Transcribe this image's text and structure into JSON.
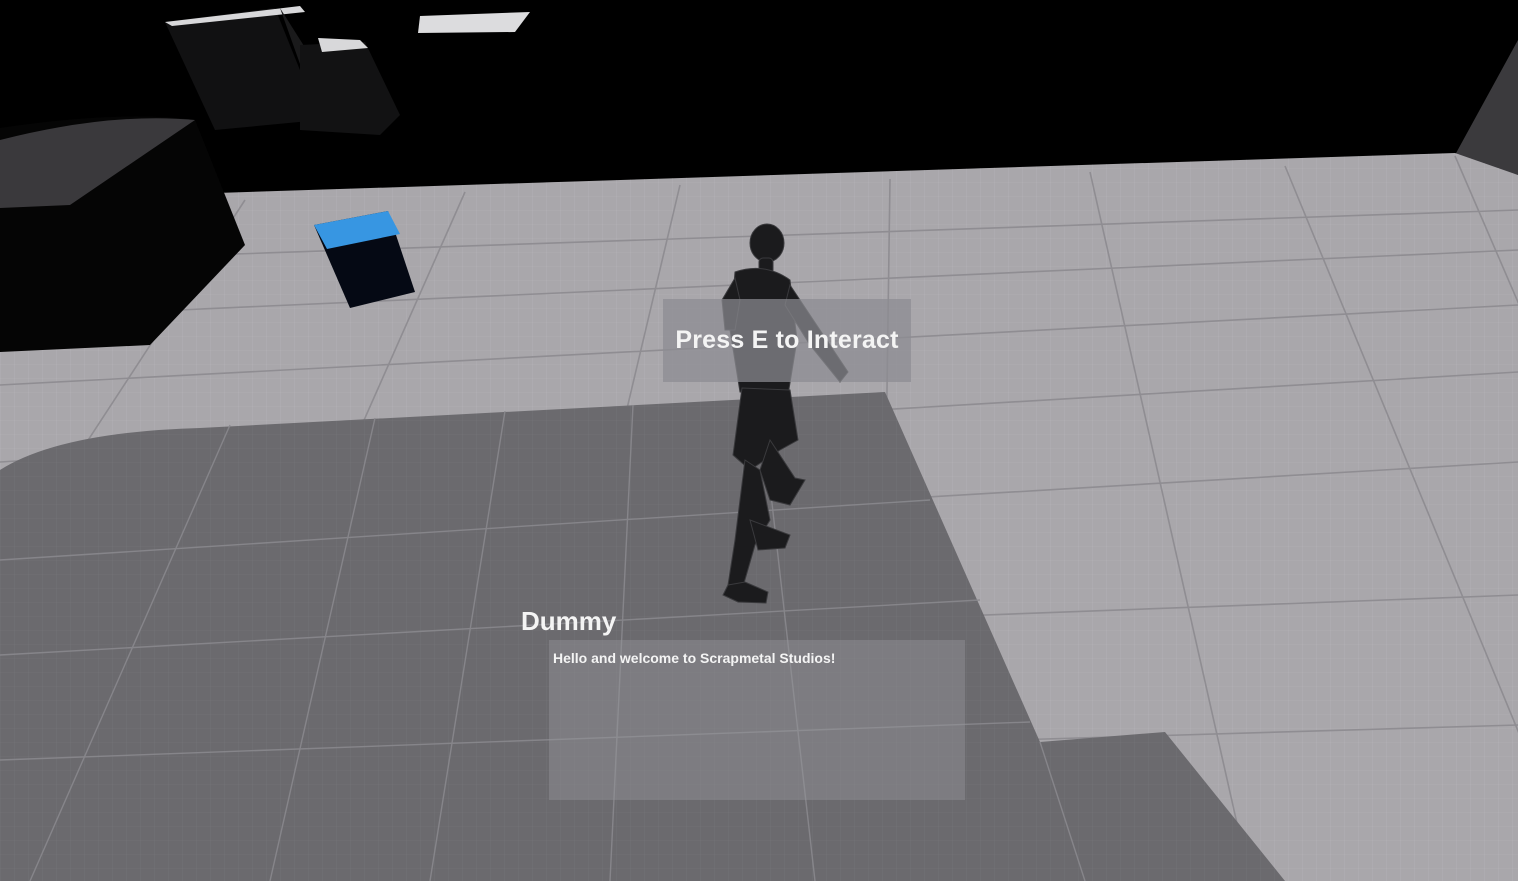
{
  "hud": {
    "interact_prompt": "Press E to Interact"
  },
  "dialogue": {
    "speaker": "Dummy",
    "text": "Hello and welcome to Scrapmetal Studios!"
  },
  "scene": {
    "floor_color": "#a9a7ab",
    "platform_color": "#6b6a6e",
    "sky_color": "#000000",
    "cube_accent_color": "#3796e2"
  }
}
